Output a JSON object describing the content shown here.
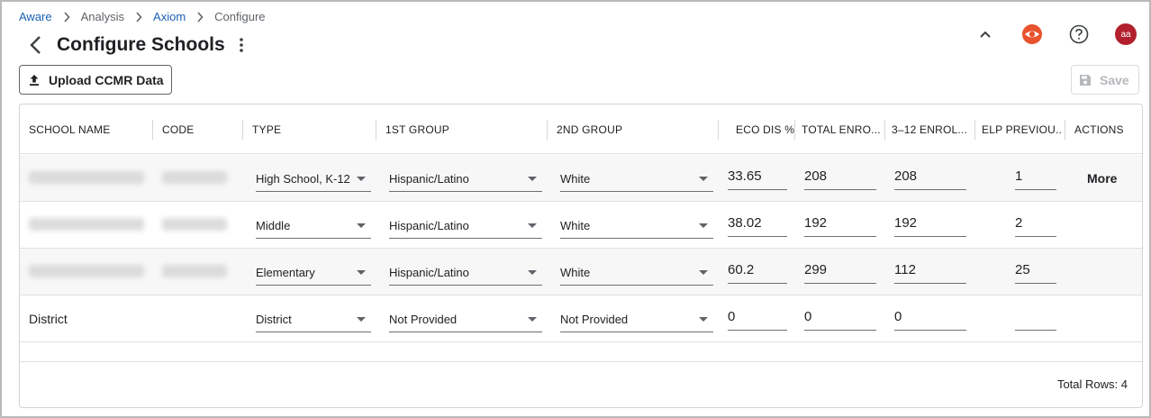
{
  "breadcrumb": {
    "items": [
      {
        "label": "Aware"
      },
      {
        "label": "Analysis"
      },
      {
        "label": "Axiom"
      },
      {
        "label": "Configure"
      }
    ]
  },
  "page": {
    "title": "Configure Schools"
  },
  "header_icons": {
    "avatar_initials": "aa"
  },
  "actions": {
    "upload_label": "Upload CCMR Data",
    "save_label": "Save"
  },
  "table": {
    "columns": [
      "SCHOOL NAME",
      "CODE",
      "TYPE",
      "1ST GROUP",
      "2ND GROUP",
      "ECO DIS %",
      "TOTAL ENRO...",
      "3–12 ENROL...",
      "ELP PREVIOU...",
      "ACTIONS"
    ],
    "rows": [
      {
        "school_name": "",
        "code": "",
        "type": "High School, K-12",
        "group1": "Hispanic/Latino",
        "group2": "White",
        "eco_dis": "33.65",
        "total_enroll": "208",
        "enroll_3_12": "208",
        "elp_previous": "1",
        "action": "More"
      },
      {
        "school_name": "",
        "code": "",
        "type": "Middle",
        "group1": "Hispanic/Latino",
        "group2": "White",
        "eco_dis": "38.02",
        "total_enroll": "192",
        "enroll_3_12": "192",
        "elp_previous": "2",
        "action": ""
      },
      {
        "school_name": "",
        "code": "",
        "type": "Elementary",
        "group1": "Hispanic/Latino",
        "group2": "White",
        "eco_dis": "60.2",
        "total_enroll": "299",
        "enroll_3_12": "112",
        "elp_previous": "25",
        "action": ""
      },
      {
        "school_name": "District",
        "code": "",
        "type": "District",
        "group1": "Not Provided",
        "group2": "Not Provided",
        "eco_dis": "0",
        "total_enroll": "0",
        "enroll_3_12": "0",
        "elp_previous": "",
        "action": ""
      }
    ],
    "footer": "Total Rows: 4"
  },
  "colors": {
    "link": "#1a5fb4",
    "avatar": "#b3202d",
    "eye_icon": "#e8522d"
  }
}
